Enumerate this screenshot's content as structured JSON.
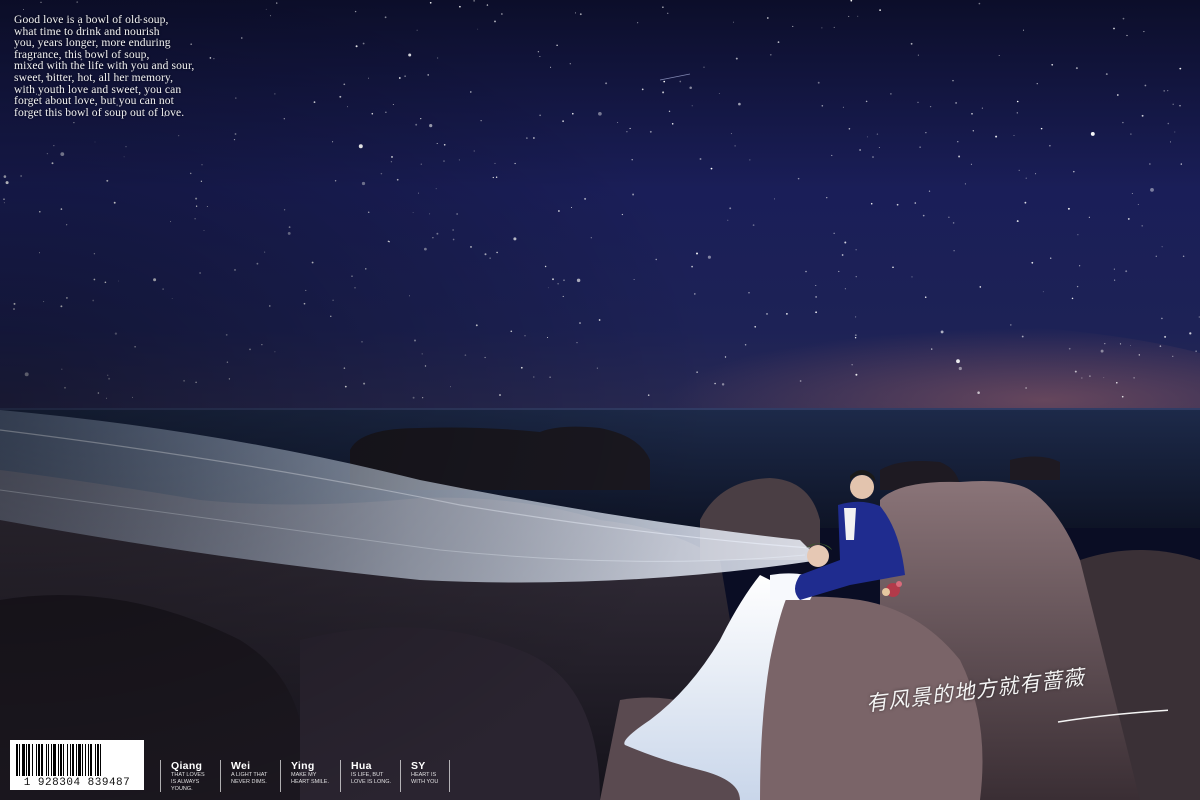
{
  "poem": {
    "lines": [
      "Good love is a bowl of old soup,",
      "what time to drink and nourish",
      "you, years longer, more enduring",
      " fragrance, this bowl of soup,",
      " mixed with the life with you and sour,",
      "sweet, bitter, hot, all her memory,",
      "with youth love and sweet, you can",
      "forget about love, but you can not",
      " forget this bowl of soup out of love."
    ]
  },
  "signature": {
    "text": "有风景的地方就有蔷薇"
  },
  "barcode": {
    "number": "1   928304   839487"
  },
  "credits": [
    {
      "name": "Qiang",
      "sub": "THAT LOVES\nIS ALWAYS YOUNG."
    },
    {
      "name": "Wei",
      "sub": "A LIGHT THAT\nNEVER DIMS."
    },
    {
      "name": "Ying",
      "sub": "MAKE MY\nHEART SMILE."
    },
    {
      "name": "Hua",
      "sub": "IS LIFE, BUT\nLOVE IS LONG."
    },
    {
      "name": "SY",
      "sub": "HEART IS\nWITH YOU"
    }
  ],
  "palette": {
    "sky_top": "#0d1030",
    "sky_mid": "#1a1f5c",
    "horizon_glow": "#6a4a5a",
    "sea": "#1a2a4a",
    "rock": "#6e5a5e",
    "veil": "#cfe0f5",
    "dress": "#f4f7fb",
    "suit": "#1c2a8a"
  }
}
